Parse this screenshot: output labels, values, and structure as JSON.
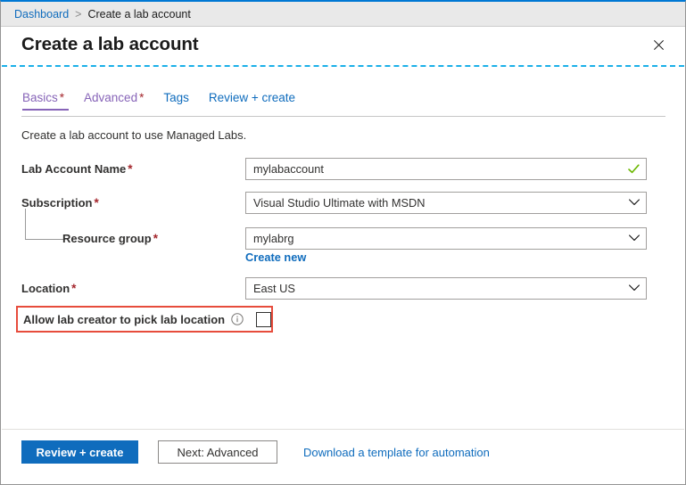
{
  "breadcrumb": {
    "root_label": "Dashboard",
    "separator": ">",
    "current_label": "Create a lab account"
  },
  "header": {
    "title": "Create a lab account",
    "close_icon": "close-icon"
  },
  "tabs": [
    {
      "label": "Basics",
      "required_marker": "*",
      "state": "active"
    },
    {
      "label": "Advanced",
      "required_marker": "*",
      "state": "incomplete"
    },
    {
      "label": "Tags",
      "required_marker": "",
      "state": "plain"
    },
    {
      "label": "Review + create",
      "required_marker": "",
      "state": "plain"
    }
  ],
  "form": {
    "description": "Create a lab account to use Managed Labs.",
    "fields": {
      "lab_account_name": {
        "label": "Lab Account Name",
        "required_marker": "*",
        "value": "mylabaccount",
        "placeholder": "",
        "validation_icon": "checkmark-icon",
        "validation_color": "#6bb700"
      },
      "subscription": {
        "label": "Subscription",
        "required_marker": "*",
        "value": "Visual Studio Ultimate with MSDN",
        "dropdown_icon": "chevron-down-icon"
      },
      "resource_group": {
        "label": "Resource group",
        "required_marker": "*",
        "value": "mylabrg",
        "dropdown_icon": "chevron-down-icon",
        "create_new_label": "Create new"
      },
      "location": {
        "label": "Location",
        "required_marker": "*",
        "value": "East US",
        "dropdown_icon": "chevron-down-icon"
      },
      "allow_lab_creator_pick_location": {
        "label": "Allow lab creator to pick lab location",
        "info_icon": "info-icon",
        "checked": false,
        "highlight_color": "#e74c3c"
      }
    }
  },
  "footer": {
    "primary_button": "Review + create",
    "secondary_button": "Next: Advanced",
    "template_link": "Download a template for automation"
  },
  "colors": {
    "accent_blue": "#0f6cbd",
    "top_bar_blue": "#0078d4",
    "tab_purple": "#8764b8",
    "required_red": "#a4262c",
    "dashed_divider_cyan": "#1bb0e8",
    "validation_green": "#6bb700",
    "highlight_red": "#e74c3c"
  }
}
